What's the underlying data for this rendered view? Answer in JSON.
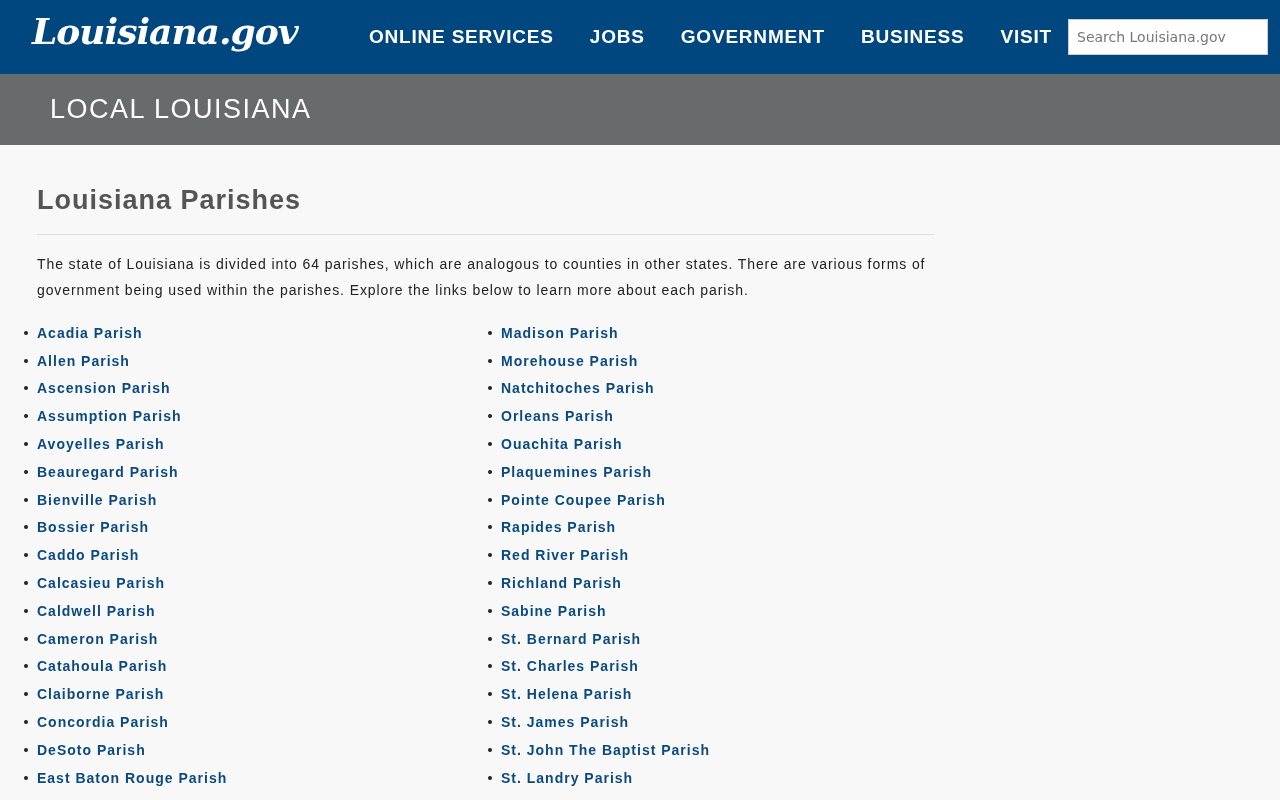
{
  "header": {
    "logo": "Louisiana.gov",
    "nav": [
      {
        "label": "ONLINE SERVICES"
      },
      {
        "label": "JOBS"
      },
      {
        "label": "GOVERNMENT"
      },
      {
        "label": "BUSINESS"
      },
      {
        "label": "VISIT"
      }
    ],
    "search": {
      "placeholder": "Search Louisiana.gov"
    }
  },
  "banner": {
    "title": "LOCAL LOUISIANA"
  },
  "heading": "Louisiana Parishes",
  "intro": "The state of Louisiana is divided into 64 parishes, which are analogous to counties in other states. There are various forms of government being used within the parishes. Explore the links below to learn more about each parish.",
  "columns": [
    [
      "Acadia Parish",
      "Allen Parish",
      "Ascension Parish",
      "Assumption Parish",
      "Avoyelles Parish",
      "Beauregard Parish",
      "Bienville Parish",
      "Bossier Parish",
      "Caddo Parish",
      "Calcasieu Parish",
      "Caldwell Parish",
      "Cameron Parish",
      "Catahoula Parish",
      "Claiborne Parish",
      "Concordia Parish",
      "DeSoto Parish",
      "East Baton Rouge Parish"
    ],
    [
      "Madison Parish",
      "Morehouse Parish",
      "Natchitoches Parish",
      "Orleans Parish",
      "Ouachita Parish",
      "Plaquemines Parish",
      "Pointe Coupee Parish",
      "Rapides Parish",
      "Red River Parish",
      "Richland Parish",
      "Sabine Parish",
      "St. Bernard Parish",
      "St. Charles Parish",
      "St. Helena Parish",
      "St. James Parish",
      "St. John The Baptist Parish",
      "St. Landry Parish"
    ]
  ]
}
